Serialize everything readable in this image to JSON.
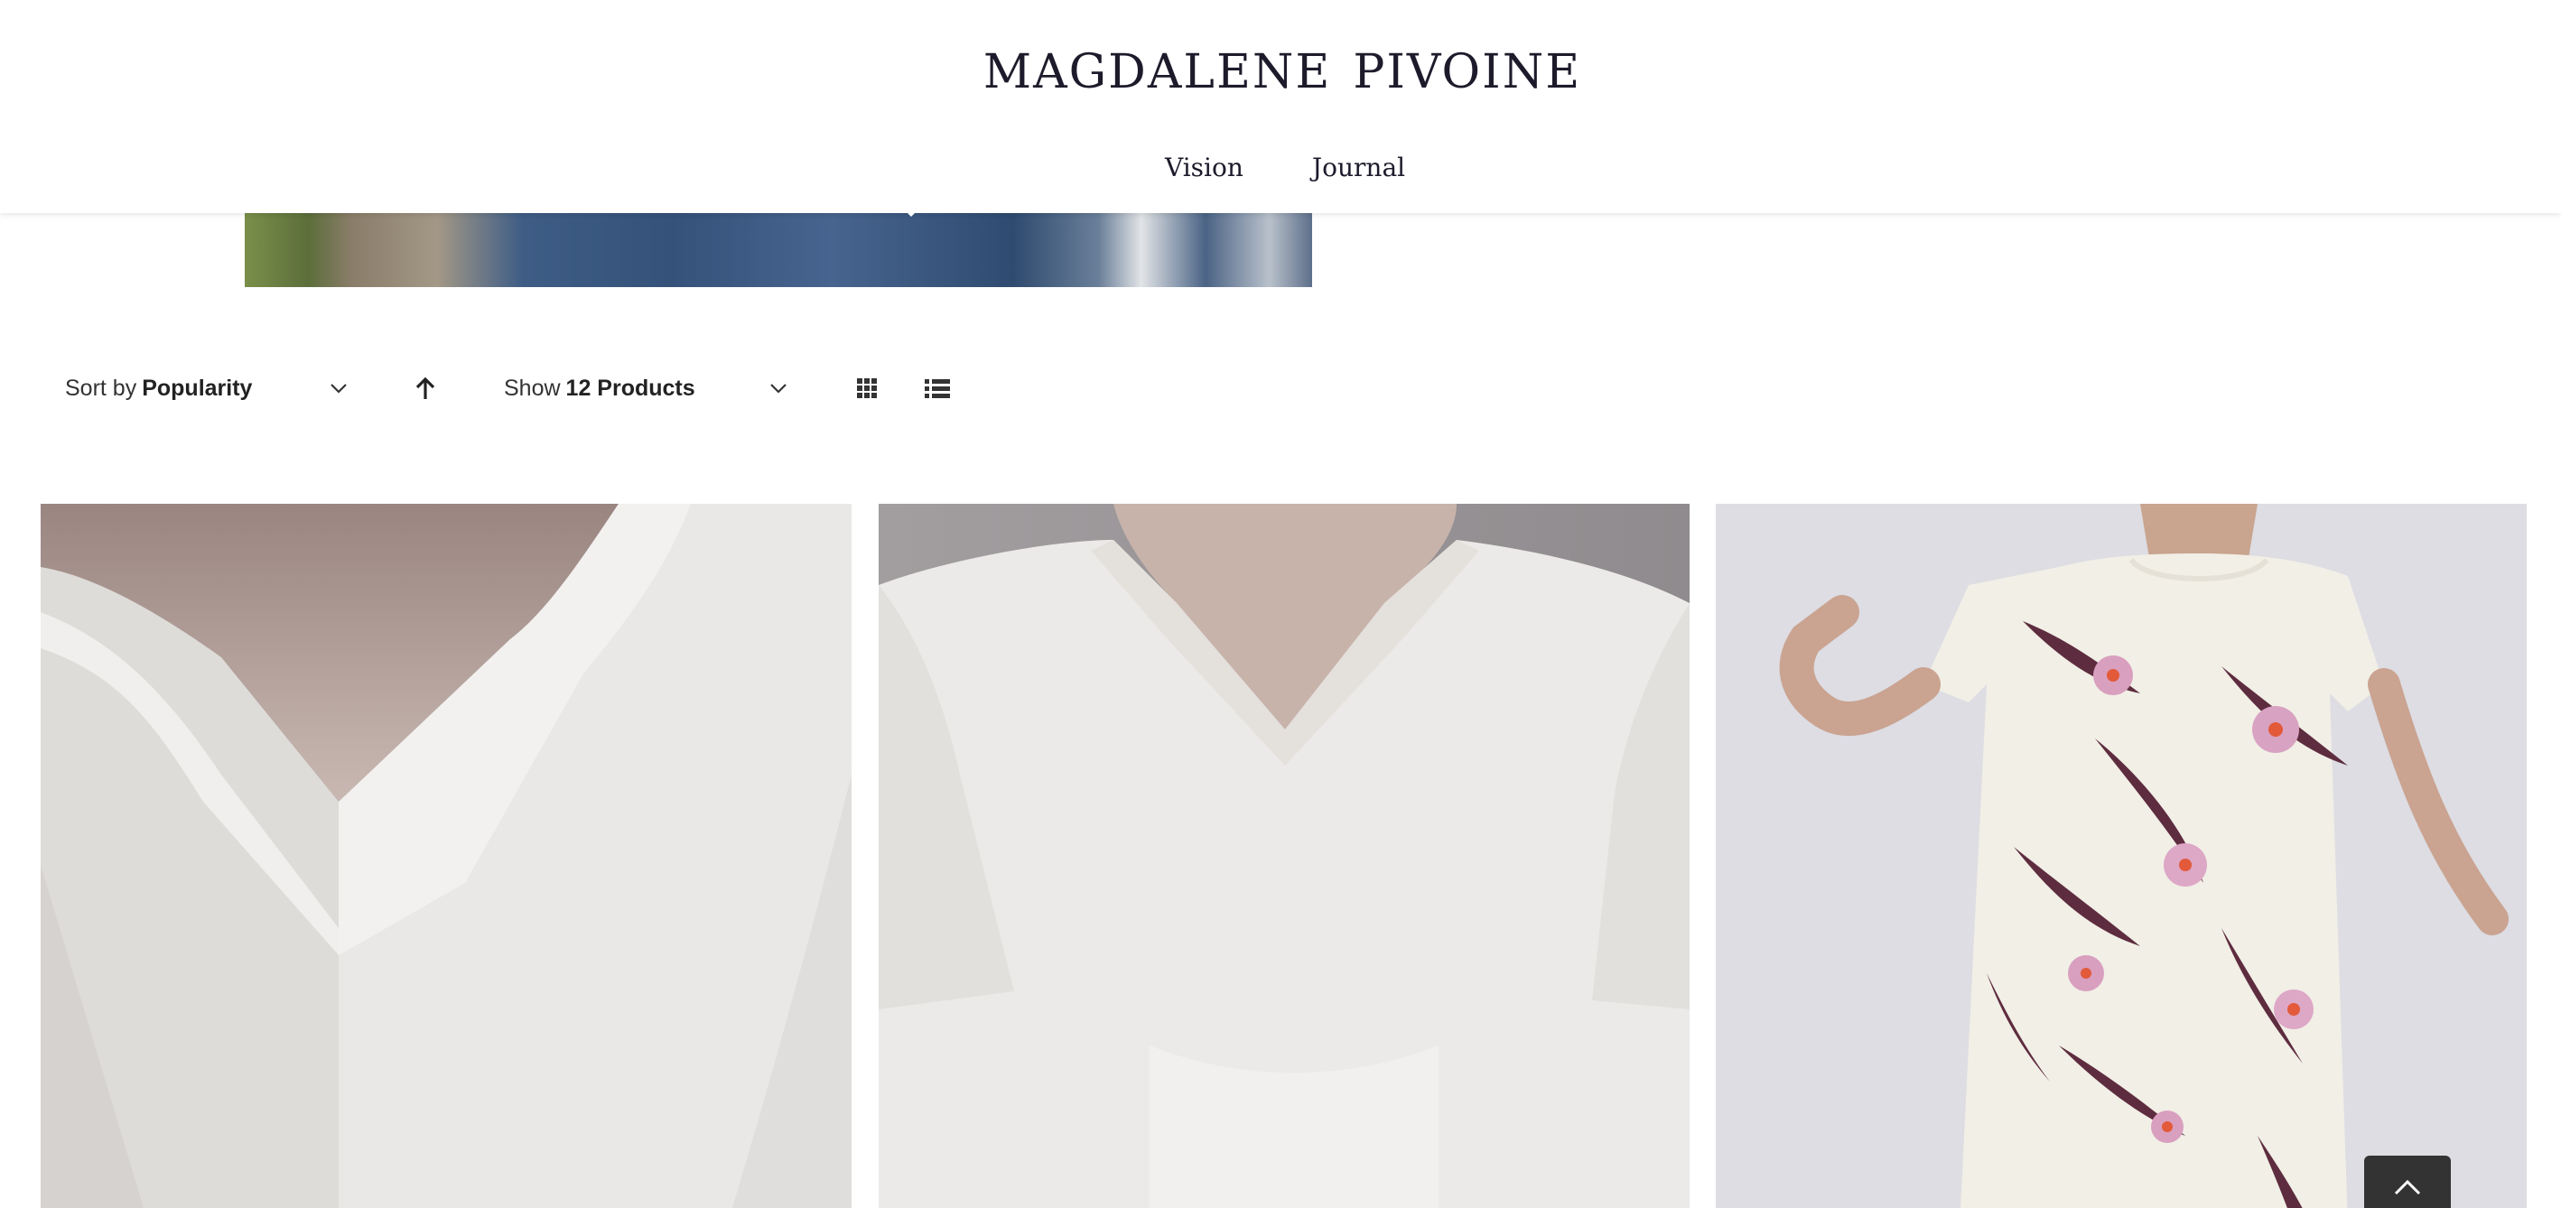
{
  "header": {
    "logo_left": "MAGDALENE",
    "logo_right": "PIVOINE",
    "logo_mark_icon": "peony-leaf-icon",
    "nav": [
      {
        "label": "Vision"
      },
      {
        "label": "Journal"
      }
    ]
  },
  "toolbar": {
    "sort_prefix": "Sort by",
    "sort_value": "Popularity",
    "sort_direction_icon": "arrow-up-icon",
    "show_prefix": "Show",
    "show_value": "12 Products",
    "grid_view_icon": "grid-view-icon",
    "list_view_icon": "list-view-icon"
  },
  "products": [
    {
      "image": "white v-neck t-shirt close-up"
    },
    {
      "image": "ivory v-neck t-shirt"
    },
    {
      "image": "white floral dress with orchid print"
    }
  ],
  "back_to_top_icon": "chevron-up-icon",
  "colors": {
    "brand_text": "#1d1b2b",
    "logo_mark": "#c9a7a2",
    "back_to_top": "#333333"
  }
}
